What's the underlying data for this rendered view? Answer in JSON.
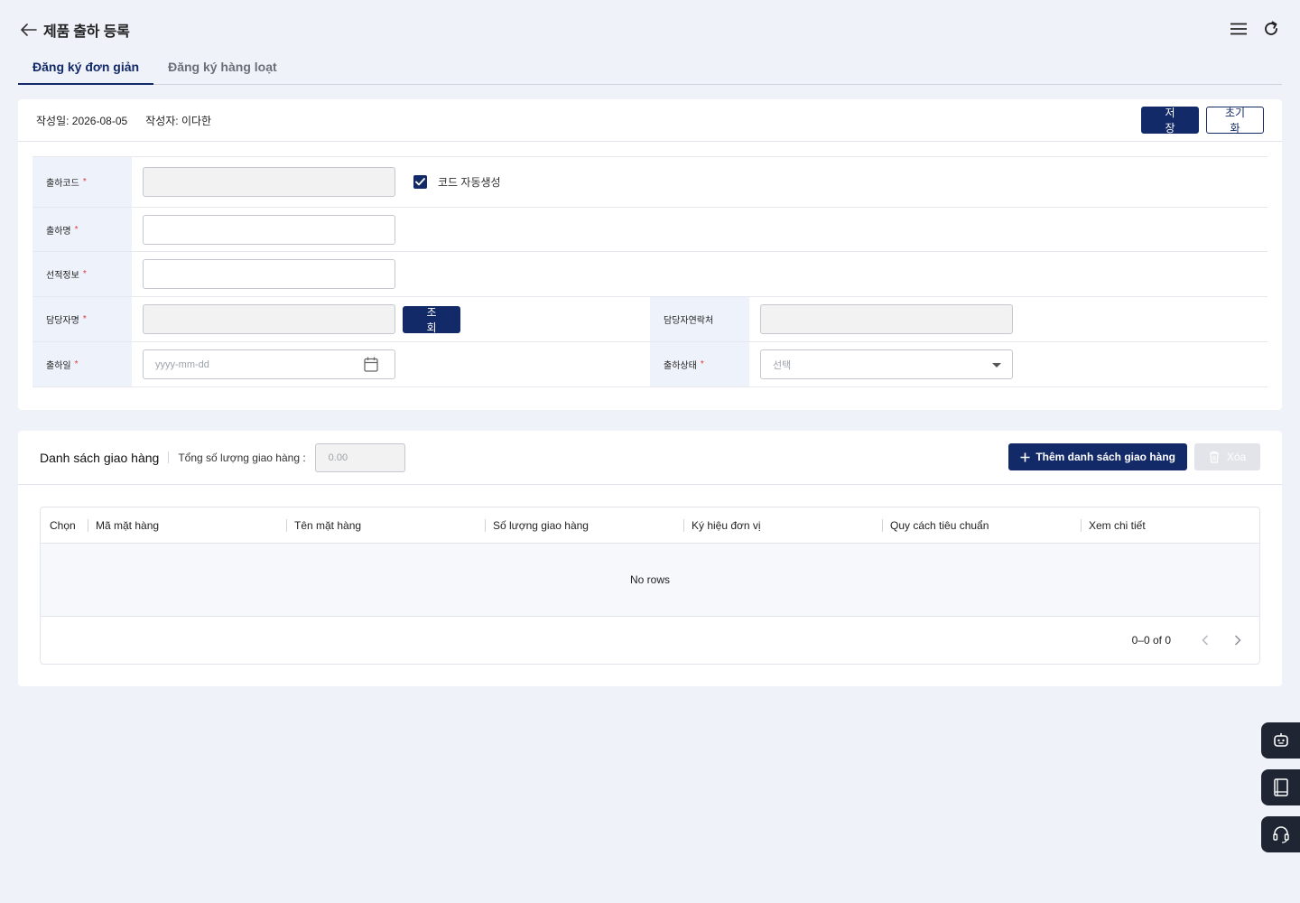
{
  "header": {
    "title": "제품 출하 등록"
  },
  "tabs": [
    {
      "label": "Đăng ký đơn giản",
      "active": true
    },
    {
      "label": "Đăng ký hàng loạt",
      "active": false
    }
  ],
  "form_card": {
    "created_date": "작성일: 2026-08-05",
    "author": "작성자: 이다한",
    "save_label": "저장",
    "reset_label": "초기화",
    "fields": {
      "code_label": "출하코드",
      "auto_code_label": "코드 자동생성",
      "auto_code_checked": true,
      "name_label": "출하명",
      "loading_info_label": "선적정보",
      "manager_label": "담당자명",
      "search_label": "조회",
      "manager_contact_label": "담당자연락처",
      "ship_date_label": "출하일",
      "ship_date_placeholder": "yyyy-mm-dd",
      "ship_status_label": "출하상태",
      "ship_status_placeholder": "선택",
      "required_mark": "*"
    }
  },
  "list_card": {
    "title": "Danh sách giao hàng",
    "total_label": "Tổng số lượng giao hàng :",
    "total_value": "0.00",
    "add_label": "Thêm danh sách giao hàng",
    "delete_label": "Xóa",
    "columns": [
      "Chọn",
      "Mã mặt hàng",
      "Tên mặt hàng",
      "Số lượng giao hàng",
      "Ký hiệu đơn vị",
      "Quy cách tiêu chuẩn",
      "Xem chi tiết"
    ],
    "empty_text": "No rows",
    "pagination": "0–0 of 0"
  },
  "colors": {
    "primary": "#132a68",
    "required": "#e03a3a",
    "label_bg": "#eef2fb",
    "page_bg": "#eff2f9",
    "floating": "#1f2533"
  },
  "floating_icons": [
    "chatbot-icon",
    "manual-book-icon",
    "headset-support-icon"
  ]
}
